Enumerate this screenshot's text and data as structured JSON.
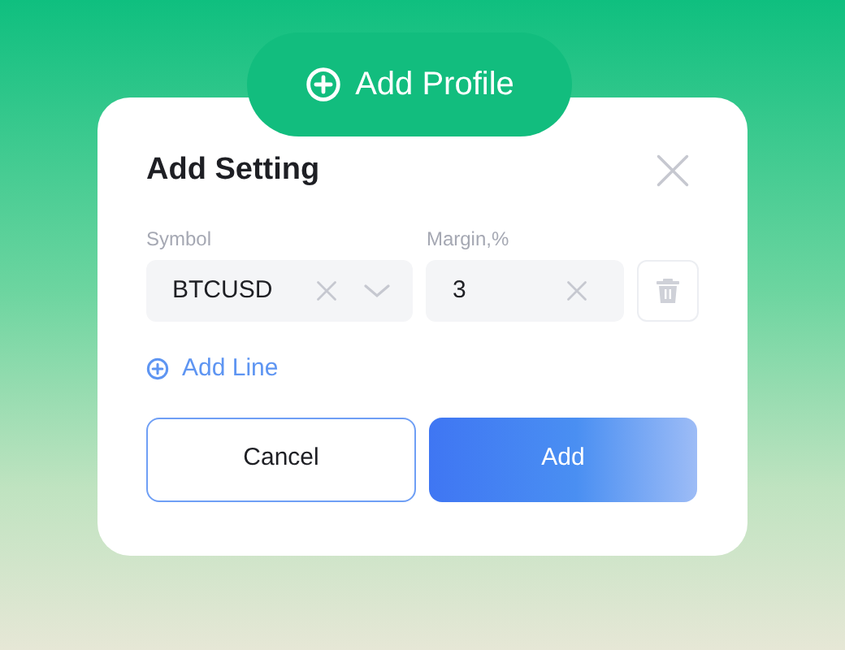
{
  "profile_button": {
    "label": "Add Profile"
  },
  "dialog": {
    "title": "Add Setting",
    "fields": [
      {
        "label": "Symbol",
        "value": "BTCUSD"
      },
      {
        "label": "Margin,%",
        "value": "3"
      }
    ],
    "add_line": {
      "label": "Add Line"
    },
    "buttons": [
      {
        "kind": "secondary",
        "label": "Cancel"
      },
      {
        "kind": "primary",
        "label": "Add"
      }
    ]
  }
}
